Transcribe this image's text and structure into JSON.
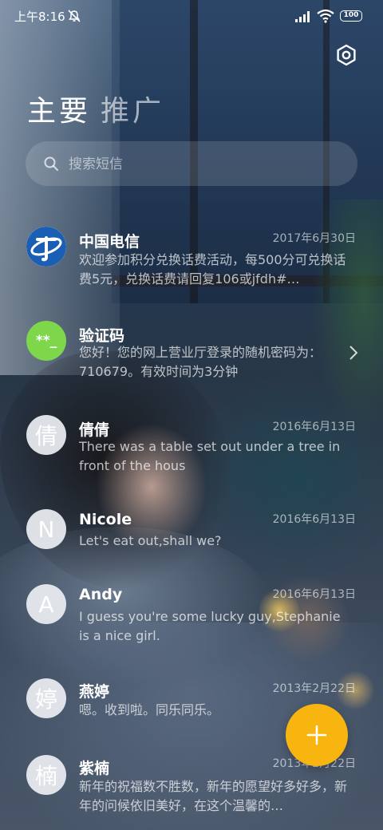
{
  "status_bar": {
    "time": "上午8:16",
    "battery": "100",
    "icons": [
      "mute-icon",
      "signal-icon",
      "wifi-icon",
      "battery-icon"
    ]
  },
  "header": {
    "settings_icon": "settings-icon",
    "tabs": [
      {
        "label": "主要",
        "active": true
      },
      {
        "label": "推广",
        "active": false
      }
    ]
  },
  "search": {
    "placeholder": "搜索短信",
    "icon": "search-icon"
  },
  "conversations": [
    {
      "name": "中国电信",
      "date": "2017年6月30日",
      "snippet": "欢迎参加积分兑换话费活动，每500分可兑换话费5元，兑换话费请回复106或jfdh#…",
      "avatar": "telecom-logo"
    },
    {
      "name": "验证码",
      "date": "",
      "snippet": "您好！您的网上营业厅登录的随机密码为：710679。有效时间为3分钟",
      "avatar": "**_"
    },
    {
      "name": "倩倩",
      "date": "2016年6月13日",
      "snippet": "There was a table set out under a tree in front of the hous",
      "avatar": "倩"
    },
    {
      "name": "Nicole",
      "date": "2016年6月13日",
      "snippet": "Let's eat out,shall we?",
      "avatar": "N"
    },
    {
      "name": "Andy",
      "date": "2016年6月13日",
      "snippet": "I guess you're some lucky guy,Stephanie is a nice girl.",
      "avatar": "A"
    },
    {
      "name": "燕婷",
      "date": "2013年2月22日",
      "snippet": "嗯。收到啦。同乐同乐。",
      "avatar": "婷"
    },
    {
      "name": "紫楠",
      "date": "2013年2月22日",
      "snippet": "新年的祝福数不胜数，新年的愿望好多好多，新年的问候依旧美好，在这个温馨的…",
      "avatar": "楠"
    }
  ],
  "colors": {
    "fab": "#f8b50f",
    "code_avatar": "#7ed64b",
    "telecom_blue": "#1a5fb4"
  },
  "fab_icon": "plus-icon"
}
